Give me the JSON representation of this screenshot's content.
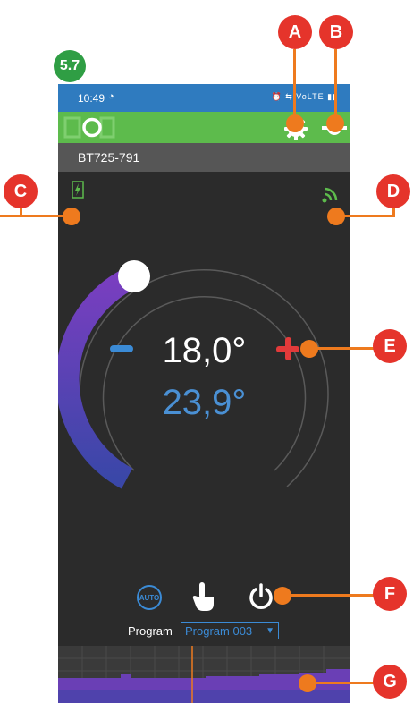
{
  "step_label": "5.7",
  "status": {
    "time": "10:49",
    "alarm_icon": "alarm-icon",
    "right_icons": "⏰ ⇆ VoLTE ▮▮"
  },
  "device": {
    "name": "BT725-791"
  },
  "thermostat": {
    "set_temp": "18,0°",
    "current_temp": "23,9°",
    "minus_label": "−",
    "plus_label": "+"
  },
  "mode_buttons": {
    "auto_label": "AUTO"
  },
  "program": {
    "label": "Program",
    "selected": "Program 003"
  },
  "callouts": {
    "a": "A",
    "b": "B",
    "c": "C",
    "d": "D",
    "e": "E",
    "f": "F",
    "g": "G"
  },
  "colors": {
    "accent_green": "#5dbb4c",
    "status_blue": "#2f7bbf",
    "callout_red": "#e5342b",
    "callout_line": "#ee7a1e",
    "dial_purple": "#6a3db8",
    "temp_blue": "#4a90d4"
  }
}
